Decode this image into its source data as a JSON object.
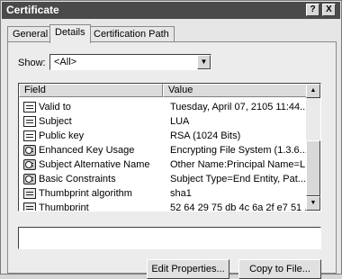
{
  "window": {
    "title": "Certificate",
    "help_button": "?",
    "close_button": "X"
  },
  "tabs": [
    {
      "label": "General"
    },
    {
      "label": "Details"
    },
    {
      "label": "Certification Path"
    }
  ],
  "show": {
    "label": "Show:",
    "selected": "<All>"
  },
  "list": {
    "headers": [
      "Field",
      "Value"
    ],
    "rows": [
      {
        "icon": "document-icon",
        "field": "Valid to",
        "value": "Tuesday, April 07, 2105 11:44..."
      },
      {
        "icon": "document-icon",
        "field": "Subject",
        "value": "LUA"
      },
      {
        "icon": "document-icon",
        "field": "Public key",
        "value": "RSA (1024 Bits)"
      },
      {
        "icon": "extension-icon",
        "field": "Enhanced Key Usage",
        "value": "Encrypting File System (1.3.6...."
      },
      {
        "icon": "extension-icon",
        "field": "Subject Alternative Name",
        "value": "Other Name:Principal Name=L..."
      },
      {
        "icon": "extension-icon",
        "field": "Basic Constraints",
        "value": "Subject Type=End Entity, Pat..."
      },
      {
        "icon": "thumbprint-icon",
        "field": "Thumbprint algorithm",
        "value": "sha1"
      },
      {
        "icon": "thumbprint-icon",
        "field": "Thumbprint",
        "value": "52 64 29 75 db 4c 6a 2f e7 51 ..."
      }
    ]
  },
  "buttons": {
    "edit_properties": "Edit Properties...",
    "copy_to_file": "Copy to File..."
  }
}
